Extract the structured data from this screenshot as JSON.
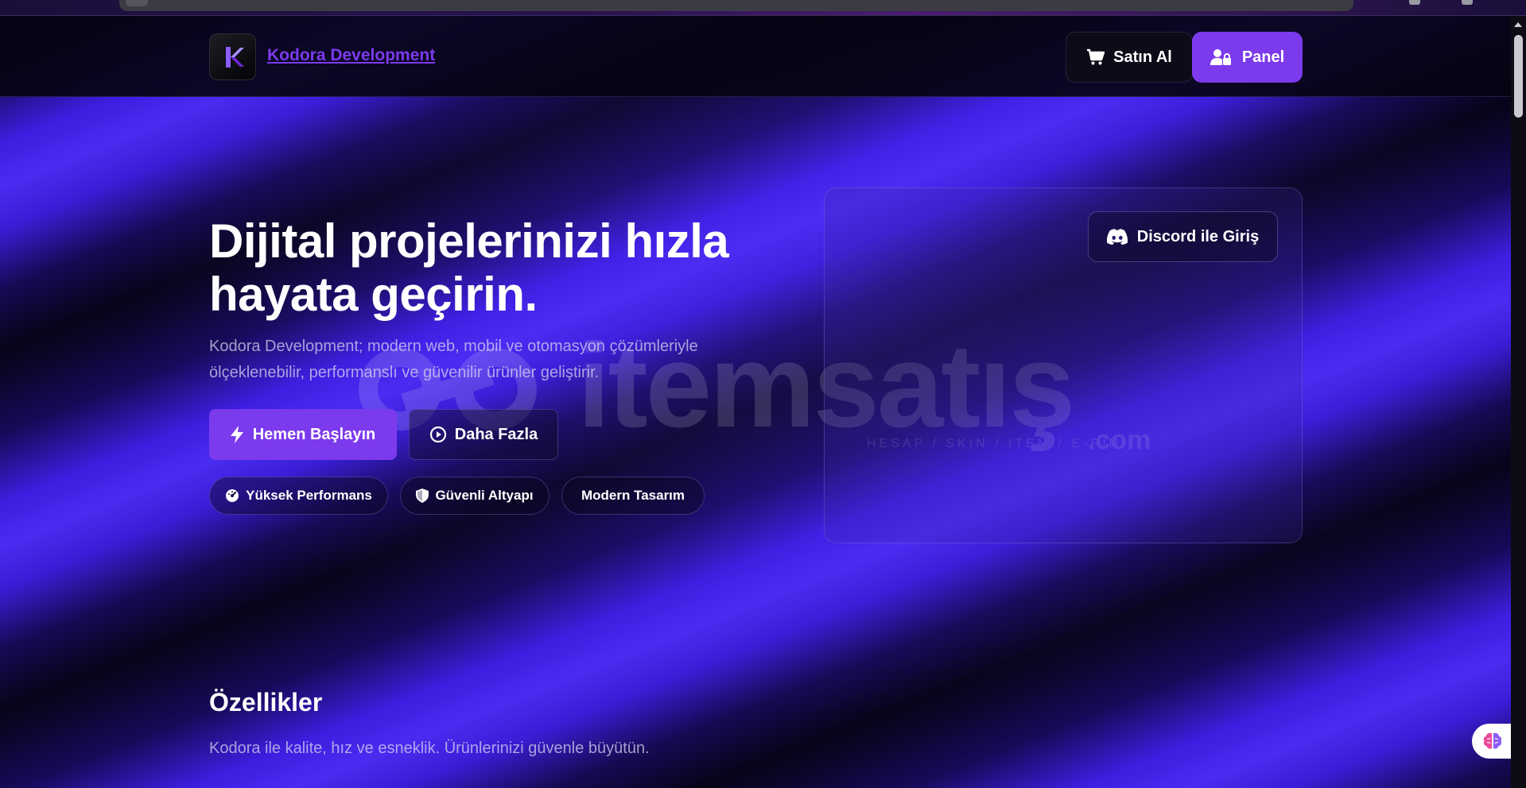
{
  "header": {
    "brand": "Kodora Development",
    "buy_label": "Satın Al",
    "panel_label": "Panel"
  },
  "hero": {
    "title_line1": "Dijital projelerinizi hızla",
    "title_line2": "hayata geçirin.",
    "subtitle_line1": "Kodora Development; modern web, mobil ve otomasyon çözümleriyle",
    "subtitle_line2": "ölçeklenebilir, performanslı ve güvenilir ürünler geliştirir.",
    "start_label": "Hemen Başlayın",
    "more_label": "Daha Fazla",
    "chips": [
      {
        "label": "Yüksek Performans",
        "icon": "gauge-icon"
      },
      {
        "label": "Güvenli Altyapı",
        "icon": "shield-icon"
      },
      {
        "label": "Modern Tasarım",
        "icon": ""
      }
    ]
  },
  "card": {
    "discord_label": "Discord ile Giriş"
  },
  "watermark": {
    "text": "itemsatış",
    "tagline": "HESAP / SKIN / ITEM / E-PIN",
    "suffix": ".com"
  },
  "features": {
    "title": "Özellikler",
    "subtitle": "Kodora ile kalite, hız ve esneklik. Ürünlerinizi güvenle büyütün."
  },
  "colors": {
    "accent": "#7c3aed",
    "background": "#07051a",
    "wave": "#4a2bf0"
  }
}
